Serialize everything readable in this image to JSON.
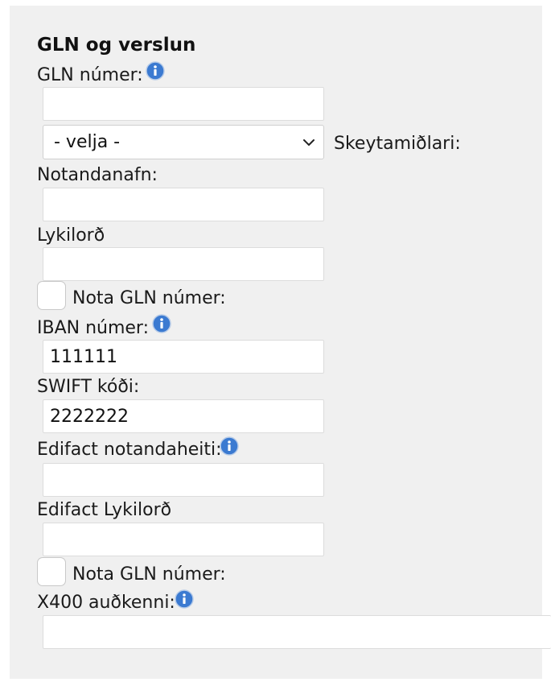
{
  "section": {
    "title": "GLN og verslun"
  },
  "fields": {
    "gln_label": "GLN númer:",
    "gln_value": "",
    "messenger_select_value": "- velja -",
    "messenger_label": "Skeytamiðlari:",
    "username_label": "Notandanafn:",
    "username_value": "",
    "password_label": "Lykilorð",
    "password_value": "",
    "use_gln_label_1": "Nota GLN númer:",
    "iban_label": "IBAN númer:",
    "iban_value": "111111",
    "swift_label": "SWIFT kóði:",
    "swift_value": "2222222",
    "edifact_user_label": "Edifact notandaheiti:",
    "edifact_user_value": "",
    "edifact_password_label": "Edifact Lykilorð",
    "edifact_password_value": "",
    "use_gln_label_2": "Nota GLN númer:",
    "x400_label": "X400 auðkenni:",
    "x400_value": ""
  },
  "icons": {
    "info": "info-icon",
    "dropdown": "chevron-down-icon"
  },
  "colors": {
    "panel_background": "#f0f0f0",
    "info_icon_blue": "#3b7ad1"
  }
}
